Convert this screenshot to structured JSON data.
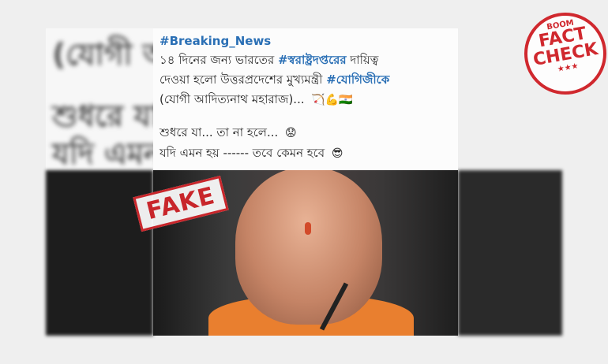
{
  "post": {
    "hashtag_line": "#Breaking_News",
    "line1_text": "১৪ দিনের জন্য ভারতের",
    "line1_hashtag": "#স্বরাষ্ট্রদপ্তরের",
    "line1_tail": "দায়িত্ব",
    "line2_text": "দেওয়া হলো উত্তরপ্রদেশের মুখ্যমন্ত্রী",
    "line2_hashtag": "#যোগিজীকে",
    "line3_text": "(যোগী আদিত্যনাথ মহারাজ)...",
    "line3_emoji": "🏹💪🇮🇳",
    "line4_text": "শুধরে যা... তা না হলে...",
    "line4_emoji": "😟",
    "line5_text": "যদি এমন হয় ------ তবে কেমন হবে",
    "line5_emoji": "😎"
  },
  "blurred_bg": {
    "line1": "(যোগী আ",
    "line2": "শুধরে যা..",
    "line3": "যদি এমন"
  },
  "stamps": {
    "fake_label": "FAKE",
    "seal_top": "BOOM",
    "seal_line1": "FACT",
    "seal_line2": "CHECK",
    "seal_stars": "★★★"
  },
  "colors": {
    "hashtag": "#2a6fb5",
    "stamp_red": "#c8262b",
    "seal_red": "#d0282e"
  }
}
